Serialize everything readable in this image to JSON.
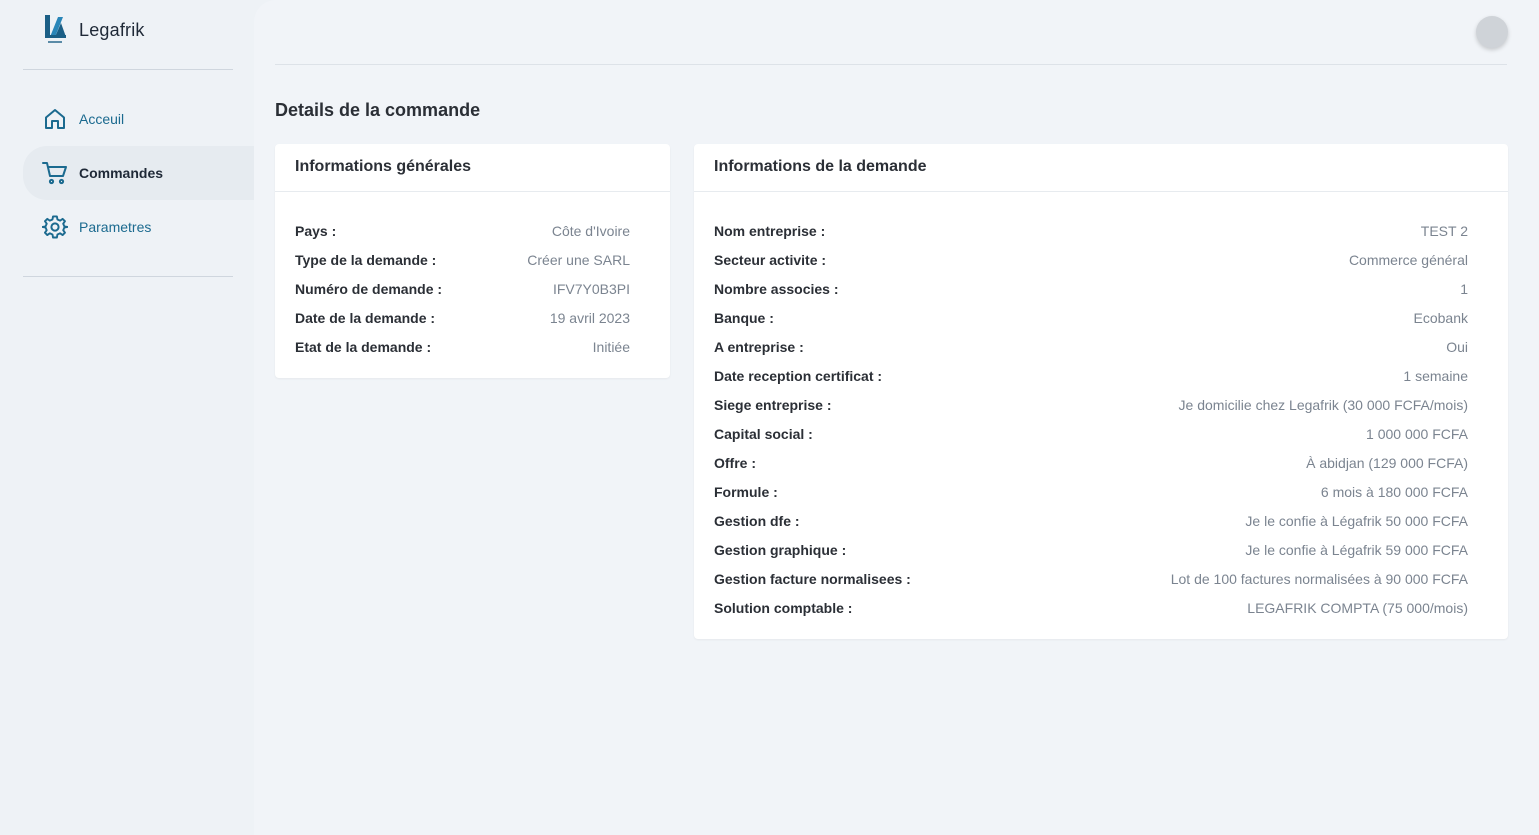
{
  "brand": {
    "name": "Legafrik"
  },
  "sidebar": {
    "items": [
      {
        "label": "Acceuil",
        "icon": "home-icon"
      },
      {
        "label": "Commandes",
        "icon": "cart-icon"
      },
      {
        "label": "Parametres",
        "icon": "gear-icon"
      }
    ]
  },
  "header": {
    "avatar_text": ""
  },
  "page": {
    "title": "Details de la commande"
  },
  "general_info": {
    "title": "Informations générales",
    "rows": [
      {
        "label": "Pays :",
        "value": "Côte d'Ivoire"
      },
      {
        "label": "Type de la demande :",
        "value": "Créer une SARL"
      },
      {
        "label": "Numéro de demande :",
        "value": "IFV7Y0B3PI"
      },
      {
        "label": "Date de la demande :",
        "value": "19 avril 2023"
      },
      {
        "label": "Etat de la demande :",
        "value": "Initiée"
      }
    ]
  },
  "request_info": {
    "title": "Informations de la demande",
    "rows": [
      {
        "label": "Nom entreprise :",
        "value": "TEST 2"
      },
      {
        "label": "Secteur activite :",
        "value": "Commerce général"
      },
      {
        "label": "Nombre associes :",
        "value": "1"
      },
      {
        "label": "Banque :",
        "value": "Ecobank"
      },
      {
        "label": "A entreprise :",
        "value": "Oui"
      },
      {
        "label": "Date reception certificat :",
        "value": "1 semaine"
      },
      {
        "label": "Siege entreprise :",
        "value": "Je domicilie chez Legafrik (30 000 FCFA/mois)"
      },
      {
        "label": "Capital social :",
        "value": "1 000 000 FCFA"
      },
      {
        "label": "Offre :",
        "value": "À abidjan (129 000 FCFA)"
      },
      {
        "label": "Formule :",
        "value": "6 mois à 180 000 FCFA"
      },
      {
        "label": "Gestion dfe :",
        "value": "Je le confie à Légafrik 50 000 FCFA"
      },
      {
        "label": "Gestion graphique :",
        "value": "Je le confie à Légafrik 59 000 FCFA"
      },
      {
        "label": "Gestion facture normalisees :",
        "value": "Lot de 100 factures normalisées à 90 000 FCFA"
      },
      {
        "label": "Solution comptable :",
        "value": "LEGAFRIK COMPTA (75 000/mois)"
      }
    ]
  },
  "colors": {
    "accent": "#1b6a8f",
    "background": "#eef2f6",
    "card": "#ffffff"
  }
}
